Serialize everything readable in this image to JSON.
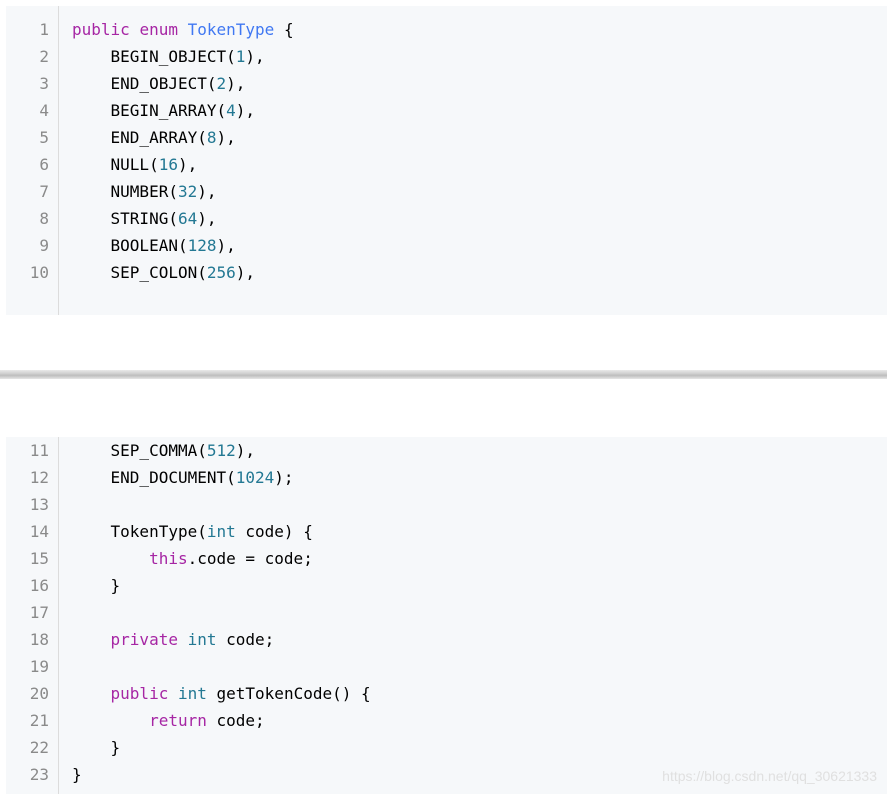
{
  "colors": {
    "keyword": "#a626a4",
    "type": "#4078f2",
    "number": "#237893",
    "line_number": "#8a8a8a",
    "code_background": "#f6f8fa"
  },
  "blocks": [
    {
      "lines": [
        {
          "n": "1",
          "indent": "",
          "tokens": [
            [
              "kw",
              "public"
            ],
            [
              "p",
              " "
            ],
            [
              "kw",
              "enum"
            ],
            [
              "p",
              " "
            ],
            [
              "ty",
              "TokenType"
            ],
            [
              "p",
              " {"
            ]
          ]
        },
        {
          "n": "2",
          "indent": "    ",
          "tokens": [
            [
              "p",
              "BEGIN_OBJECT("
            ],
            [
              "num",
              "1"
            ],
            [
              "p",
              "),"
            ]
          ]
        },
        {
          "n": "3",
          "indent": "    ",
          "tokens": [
            [
              "p",
              "END_OBJECT("
            ],
            [
              "num",
              "2"
            ],
            [
              "p",
              "),"
            ]
          ]
        },
        {
          "n": "4",
          "indent": "    ",
          "tokens": [
            [
              "p",
              "BEGIN_ARRAY("
            ],
            [
              "num",
              "4"
            ],
            [
              "p",
              "),"
            ]
          ]
        },
        {
          "n": "5",
          "indent": "    ",
          "tokens": [
            [
              "p",
              "END_ARRAY("
            ],
            [
              "num",
              "8"
            ],
            [
              "p",
              "),"
            ]
          ]
        },
        {
          "n": "6",
          "indent": "    ",
          "tokens": [
            [
              "p",
              "NULL("
            ],
            [
              "num",
              "16"
            ],
            [
              "p",
              "),"
            ]
          ]
        },
        {
          "n": "7",
          "indent": "    ",
          "tokens": [
            [
              "p",
              "NUMBER("
            ],
            [
              "num",
              "32"
            ],
            [
              "p",
              "),"
            ]
          ]
        },
        {
          "n": "8",
          "indent": "    ",
          "tokens": [
            [
              "p",
              "STRING("
            ],
            [
              "num",
              "64"
            ],
            [
              "p",
              "),"
            ]
          ]
        },
        {
          "n": "9",
          "indent": "    ",
          "tokens": [
            [
              "p",
              "BOOLEAN("
            ],
            [
              "num",
              "128"
            ],
            [
              "p",
              "),"
            ]
          ]
        },
        {
          "n": "10",
          "indent": "    ",
          "tokens": [
            [
              "p",
              "SEP_COLON("
            ],
            [
              "num",
              "256"
            ],
            [
              "p",
              "),"
            ]
          ]
        }
      ]
    },
    {
      "lines": [
        {
          "n": "11",
          "indent": "    ",
          "tokens": [
            [
              "p",
              "SEP_COMMA("
            ],
            [
              "num",
              "512"
            ],
            [
              "p",
              "),"
            ]
          ]
        },
        {
          "n": "12",
          "indent": "    ",
          "tokens": [
            [
              "p",
              "END_DOCUMENT("
            ],
            [
              "num",
              "1024"
            ],
            [
              "p",
              ");"
            ]
          ]
        },
        {
          "n": "13",
          "indent": "",
          "tokens": []
        },
        {
          "n": "14",
          "indent": "    ",
          "tokens": [
            [
              "p",
              "TokenType("
            ],
            [
              "prim",
              "int"
            ],
            [
              "p",
              " code) {"
            ]
          ]
        },
        {
          "n": "15",
          "indent": "        ",
          "tokens": [
            [
              "kw",
              "this"
            ],
            [
              "p",
              ".code = code;"
            ]
          ]
        },
        {
          "n": "16",
          "indent": "    ",
          "tokens": [
            [
              "p",
              "}"
            ]
          ]
        },
        {
          "n": "17",
          "indent": "",
          "tokens": []
        },
        {
          "n": "18",
          "indent": "    ",
          "tokens": [
            [
              "kw",
              "private"
            ],
            [
              "p",
              " "
            ],
            [
              "prim",
              "int"
            ],
            [
              "p",
              " code;"
            ]
          ]
        },
        {
          "n": "19",
          "indent": "",
          "tokens": []
        },
        {
          "n": "20",
          "indent": "    ",
          "tokens": [
            [
              "kw",
              "public"
            ],
            [
              "p",
              " "
            ],
            [
              "prim",
              "int"
            ],
            [
              "p",
              " getTokenCode() {"
            ]
          ]
        },
        {
          "n": "21",
          "indent": "        ",
          "tokens": [
            [
              "kw",
              "return"
            ],
            [
              "p",
              " code;"
            ]
          ]
        },
        {
          "n": "22",
          "indent": "    ",
          "tokens": [
            [
              "p",
              "}"
            ]
          ]
        },
        {
          "n": "23",
          "indent": "",
          "tokens": [
            [
              "p",
              "}"
            ]
          ]
        }
      ]
    }
  ],
  "watermark": "https://blog.csdn.net/qq_30621333"
}
